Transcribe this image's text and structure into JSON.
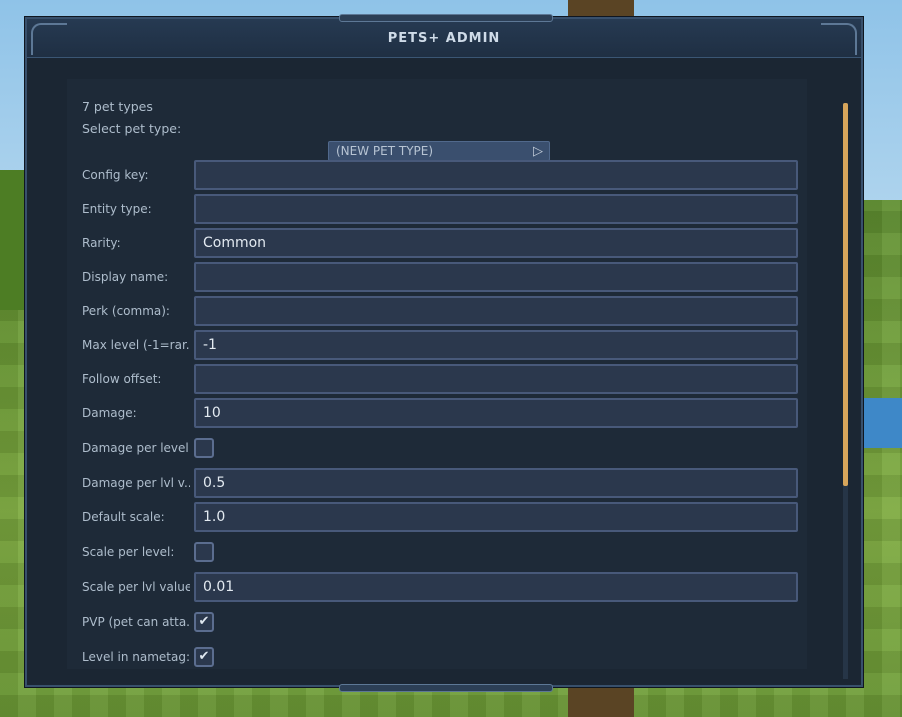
{
  "window": {
    "title": "PETS+ ADMIN"
  },
  "info": {
    "count_text": "7 pet types",
    "select_label": "Select pet type:"
  },
  "pet_type_select": {
    "value": "(NEW PET TYPE)",
    "icon": "play-icon"
  },
  "fields": [
    {
      "label": "Config key:",
      "value": ""
    },
    {
      "label": "Entity type:",
      "value": ""
    },
    {
      "label": "Rarity:",
      "value": "Common"
    },
    {
      "label": "Display name:",
      "value": ""
    },
    {
      "label": "Perk (comma):",
      "value": ""
    },
    {
      "label": "Max level (-1=rar...",
      "value": "-1"
    },
    {
      "label": "Follow offset:",
      "value": ""
    },
    {
      "label": "Damage:",
      "value": "10"
    },
    {
      "label": "Damage per level:",
      "checked": false
    },
    {
      "label": "Damage per lvl v...",
      "value": "0.5"
    },
    {
      "label": "Default scale:",
      "value": "1.0"
    },
    {
      "label": "Scale per level:",
      "checked": false
    },
    {
      "label": "Scale per lvl value:",
      "value": "0.01"
    },
    {
      "label": "PVP (pet can atta...",
      "checked": true
    },
    {
      "label": "Level in nametag:",
      "checked": true
    }
  ],
  "colors": {
    "scroll_thumb": "#d7a55b",
    "panel": "#1b2633",
    "field_border": "#48597a"
  }
}
